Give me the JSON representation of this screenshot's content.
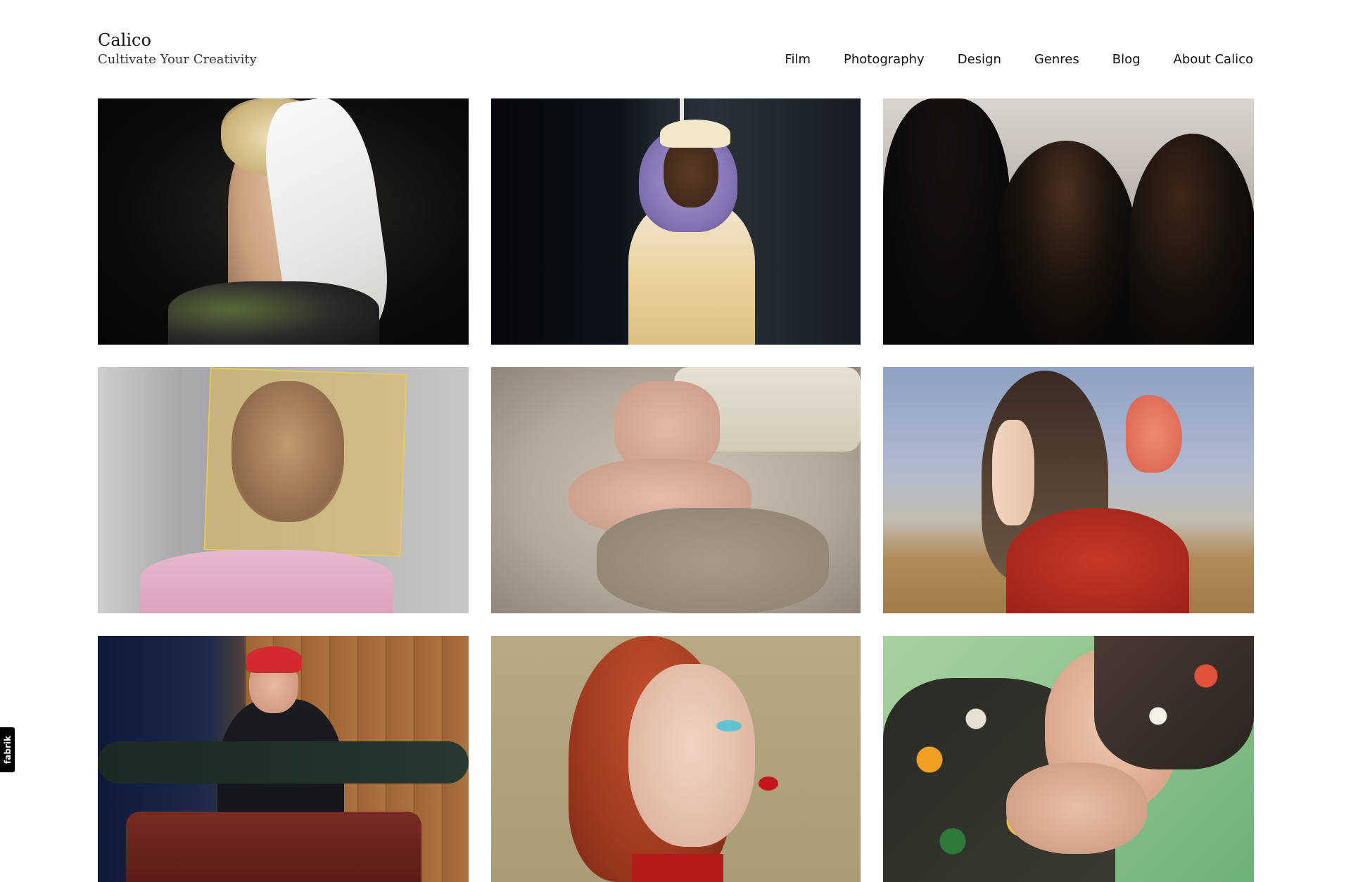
{
  "site": {
    "name": "Calico",
    "tagline": "Cultivate Your Creativity"
  },
  "nav": {
    "items": [
      "Film",
      "Photography",
      "Design",
      "Genres",
      "Blog",
      "About Calico"
    ]
  },
  "gallery": {
    "tiles": [
      {
        "name": "gallery-photo-white-glove"
      },
      {
        "name": "gallery-photo-yellow-cap"
      },
      {
        "name": "gallery-photo-three-women"
      },
      {
        "name": "gallery-photo-yellow-frame"
      },
      {
        "name": "gallery-photo-knit-hands"
      },
      {
        "name": "gallery-photo-pink-bow"
      },
      {
        "name": "gallery-photo-red-cap"
      },
      {
        "name": "gallery-photo-red-hair"
      },
      {
        "name": "gallery-photo-floral-jacket"
      }
    ]
  },
  "badge": {
    "label": "fabrik"
  }
}
